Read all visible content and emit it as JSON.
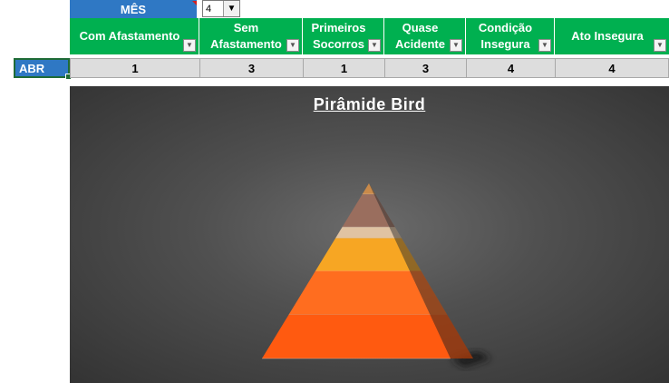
{
  "month_selector": {
    "label": "MÊS",
    "value": "4",
    "dropdown_icon": "chevron-down-icon"
  },
  "table": {
    "headers": [
      "Com Afastamento",
      "Sem Afastamento",
      "Primeiros Socorros",
      "Quase Acidente",
      "Condição Insegura",
      "Ato Insegura"
    ],
    "row_label": "ABR",
    "values": [
      "1",
      "3",
      "1",
      "3",
      "4",
      "4"
    ]
  },
  "colors": {
    "header_green": "#00b050",
    "label_blue": "#2f78c4",
    "cell_gray": "#dddddd"
  },
  "chart_data": {
    "type": "pyramid",
    "title": "Pirâmide Bird",
    "layers": [
      {
        "name": "Com Afastamento",
        "color": "#c98a4a"
      },
      {
        "name": "Sem Afastamento",
        "color": "#9a6e5e"
      },
      {
        "name": "Primeiros Socorros",
        "color": "#e0c3a2"
      },
      {
        "name": "Quase Acidente",
        "color": "#f7a623"
      },
      {
        "name": "Condição Insegura",
        "color": "#ff6d1f"
      },
      {
        "name": "Ato Insegura",
        "color": "#ff5a10"
      }
    ],
    "values": [
      1,
      3,
      1,
      3,
      4,
      4
    ]
  }
}
